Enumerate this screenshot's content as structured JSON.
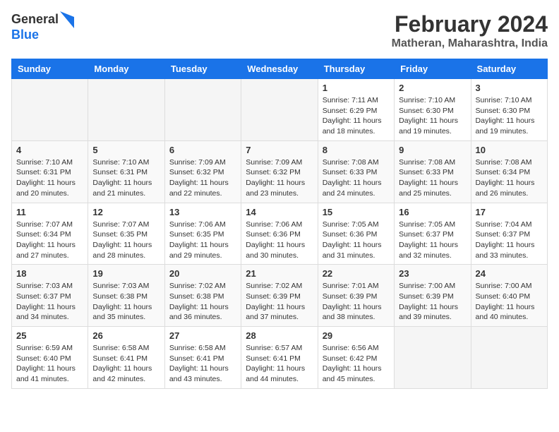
{
  "logo": {
    "line1": "General",
    "line2": "Blue"
  },
  "title": "February 2024",
  "subtitle": "Matheran, Maharashtra, India",
  "weekdays": [
    "Sunday",
    "Monday",
    "Tuesday",
    "Wednesday",
    "Thursday",
    "Friday",
    "Saturday"
  ],
  "weeks": [
    [
      {
        "day": "",
        "text": ""
      },
      {
        "day": "",
        "text": ""
      },
      {
        "day": "",
        "text": ""
      },
      {
        "day": "",
        "text": ""
      },
      {
        "day": "1",
        "text": "Sunrise: 7:11 AM\nSunset: 6:29 PM\nDaylight: 11 hours\nand 18 minutes."
      },
      {
        "day": "2",
        "text": "Sunrise: 7:10 AM\nSunset: 6:30 PM\nDaylight: 11 hours\nand 19 minutes."
      },
      {
        "day": "3",
        "text": "Sunrise: 7:10 AM\nSunset: 6:30 PM\nDaylight: 11 hours\nand 19 minutes."
      }
    ],
    [
      {
        "day": "4",
        "text": "Sunrise: 7:10 AM\nSunset: 6:31 PM\nDaylight: 11 hours\nand 20 minutes."
      },
      {
        "day": "5",
        "text": "Sunrise: 7:10 AM\nSunset: 6:31 PM\nDaylight: 11 hours\nand 21 minutes."
      },
      {
        "day": "6",
        "text": "Sunrise: 7:09 AM\nSunset: 6:32 PM\nDaylight: 11 hours\nand 22 minutes."
      },
      {
        "day": "7",
        "text": "Sunrise: 7:09 AM\nSunset: 6:32 PM\nDaylight: 11 hours\nand 23 minutes."
      },
      {
        "day": "8",
        "text": "Sunrise: 7:08 AM\nSunset: 6:33 PM\nDaylight: 11 hours\nand 24 minutes."
      },
      {
        "day": "9",
        "text": "Sunrise: 7:08 AM\nSunset: 6:33 PM\nDaylight: 11 hours\nand 25 minutes."
      },
      {
        "day": "10",
        "text": "Sunrise: 7:08 AM\nSunset: 6:34 PM\nDaylight: 11 hours\nand 26 minutes."
      }
    ],
    [
      {
        "day": "11",
        "text": "Sunrise: 7:07 AM\nSunset: 6:34 PM\nDaylight: 11 hours\nand 27 minutes."
      },
      {
        "day": "12",
        "text": "Sunrise: 7:07 AM\nSunset: 6:35 PM\nDaylight: 11 hours\nand 28 minutes."
      },
      {
        "day": "13",
        "text": "Sunrise: 7:06 AM\nSunset: 6:35 PM\nDaylight: 11 hours\nand 29 minutes."
      },
      {
        "day": "14",
        "text": "Sunrise: 7:06 AM\nSunset: 6:36 PM\nDaylight: 11 hours\nand 30 minutes."
      },
      {
        "day": "15",
        "text": "Sunrise: 7:05 AM\nSunset: 6:36 PM\nDaylight: 11 hours\nand 31 minutes."
      },
      {
        "day": "16",
        "text": "Sunrise: 7:05 AM\nSunset: 6:37 PM\nDaylight: 11 hours\nand 32 minutes."
      },
      {
        "day": "17",
        "text": "Sunrise: 7:04 AM\nSunset: 6:37 PM\nDaylight: 11 hours\nand 33 minutes."
      }
    ],
    [
      {
        "day": "18",
        "text": "Sunrise: 7:03 AM\nSunset: 6:37 PM\nDaylight: 11 hours\nand 34 minutes."
      },
      {
        "day": "19",
        "text": "Sunrise: 7:03 AM\nSunset: 6:38 PM\nDaylight: 11 hours\nand 35 minutes."
      },
      {
        "day": "20",
        "text": "Sunrise: 7:02 AM\nSunset: 6:38 PM\nDaylight: 11 hours\nand 36 minutes."
      },
      {
        "day": "21",
        "text": "Sunrise: 7:02 AM\nSunset: 6:39 PM\nDaylight: 11 hours\nand 37 minutes."
      },
      {
        "day": "22",
        "text": "Sunrise: 7:01 AM\nSunset: 6:39 PM\nDaylight: 11 hours\nand 38 minutes."
      },
      {
        "day": "23",
        "text": "Sunrise: 7:00 AM\nSunset: 6:39 PM\nDaylight: 11 hours\nand 39 minutes."
      },
      {
        "day": "24",
        "text": "Sunrise: 7:00 AM\nSunset: 6:40 PM\nDaylight: 11 hours\nand 40 minutes."
      }
    ],
    [
      {
        "day": "25",
        "text": "Sunrise: 6:59 AM\nSunset: 6:40 PM\nDaylight: 11 hours\nand 41 minutes."
      },
      {
        "day": "26",
        "text": "Sunrise: 6:58 AM\nSunset: 6:41 PM\nDaylight: 11 hours\nand 42 minutes."
      },
      {
        "day": "27",
        "text": "Sunrise: 6:58 AM\nSunset: 6:41 PM\nDaylight: 11 hours\nand 43 minutes."
      },
      {
        "day": "28",
        "text": "Sunrise: 6:57 AM\nSunset: 6:41 PM\nDaylight: 11 hours\nand 44 minutes."
      },
      {
        "day": "29",
        "text": "Sunrise: 6:56 AM\nSunset: 6:42 PM\nDaylight: 11 hours\nand 45 minutes."
      },
      {
        "day": "",
        "text": ""
      },
      {
        "day": "",
        "text": ""
      }
    ]
  ]
}
